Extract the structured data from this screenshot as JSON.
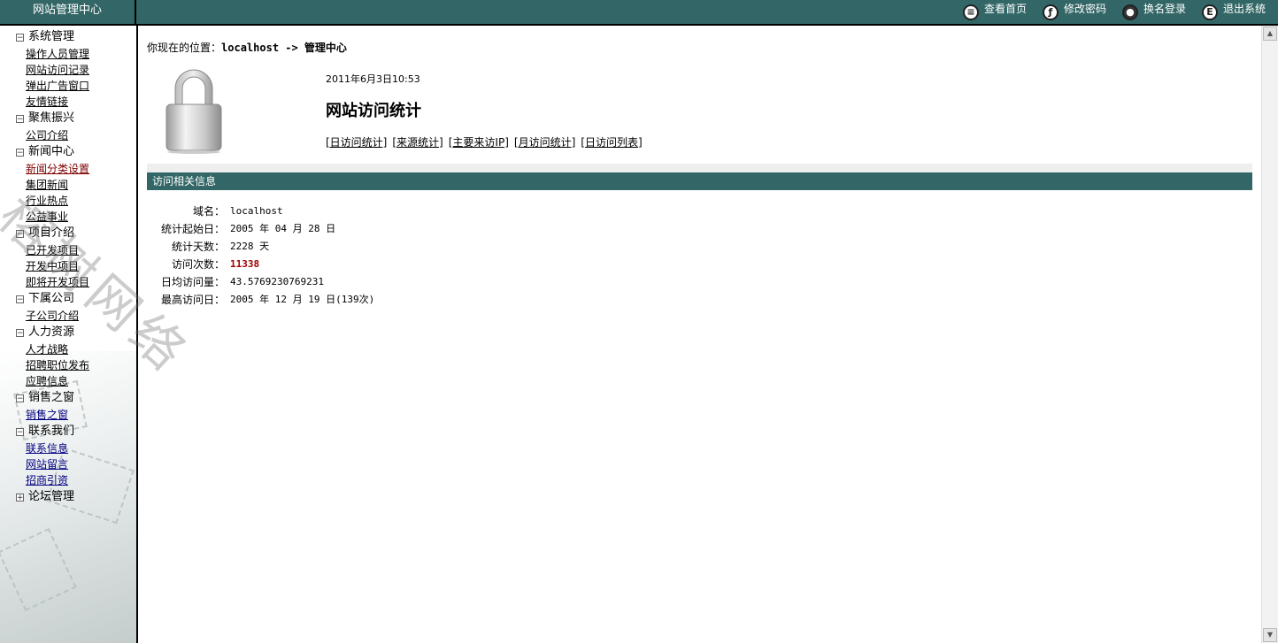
{
  "header": {
    "site_title": "网站管理中心",
    "links": [
      {
        "label": "查看首页",
        "icon": "home-icon"
      },
      {
        "label": "修改密码",
        "icon": "key-icon"
      },
      {
        "label": "换名登录",
        "icon": "user-icon"
      },
      {
        "label": "退出系统",
        "icon": "exit-icon"
      }
    ]
  },
  "sidebar": {
    "groups": [
      {
        "title": "系统管理",
        "expanded": true,
        "items": [
          "操作人员管理",
          "网站访问记录",
          "弹出广告窗口",
          "友情链接"
        ]
      },
      {
        "title": "聚焦振兴",
        "expanded": true,
        "items": [
          "公司介绍"
        ]
      },
      {
        "title": "新闻中心",
        "expanded": true,
        "items": [
          "新闻分类设置",
          "集团新闻",
          "行业热点",
          "公益事业"
        ]
      },
      {
        "title": "项目介绍",
        "expanded": true,
        "items": [
          "已开发项目",
          "开发中项目",
          "即将开发项目"
        ]
      },
      {
        "title": "下属公司",
        "expanded": true,
        "items": [
          "子公司介绍"
        ]
      },
      {
        "title": "人力资源",
        "expanded": true,
        "items": [
          "人才战略",
          "招聘职位发布",
          "应聘信息"
        ]
      },
      {
        "title": "销售之窗",
        "expanded": true,
        "items": [
          "销售之窗"
        ]
      },
      {
        "title": "联系我们",
        "expanded": true,
        "items": [
          "联系信息",
          "网站留言",
          "招商引资"
        ]
      },
      {
        "title": "论坛管理",
        "expanded": false,
        "items": []
      }
    ]
  },
  "main": {
    "location_prefix": "你现在的位置：",
    "location_path": "localhost -> 管理中心",
    "datetime": "2011年6月3日10:53",
    "title": "网站访问统计",
    "subnav": [
      "[日访问统计]",
      "[来源统计]",
      "[主要来访IP]",
      "[月访问统计]",
      "[日访问列表]"
    ],
    "section_title": "访问相关信息",
    "info": [
      {
        "label": "域名：",
        "value": "localhost"
      },
      {
        "label": "统计起始日：",
        "value": "2005 年 04 月 28 日"
      },
      {
        "label": "统计天数：",
        "value": "2228 天"
      },
      {
        "label": "访问次数：",
        "value": "11338"
      },
      {
        "label": "日均访问量：",
        "value": "43.5769230769231"
      },
      {
        "label": "最高访问日：",
        "value": "2005 年 12 月 19 日(139次)"
      }
    ]
  },
  "watermark": "榕树网络"
}
